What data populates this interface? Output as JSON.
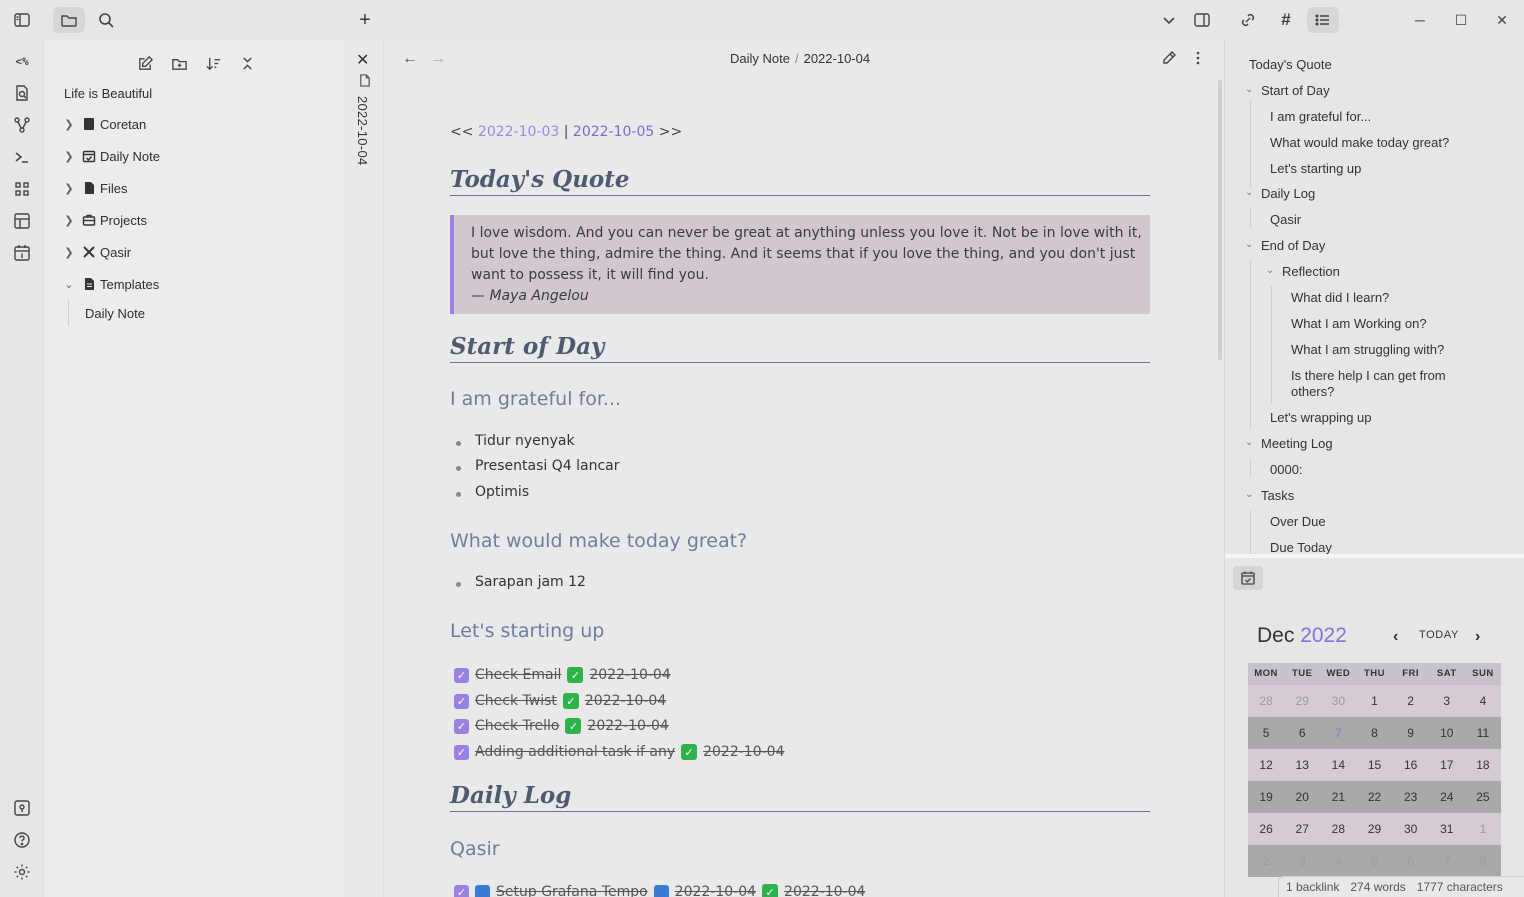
{
  "topbar": {
    "icons": [
      "sidebar-toggle-icon",
      "folder-icon",
      "search-icon",
      "plus-icon",
      "chevron-down-icon",
      "split-view-icon",
      "link-icon",
      "hashtag-icon",
      "list-icon"
    ],
    "window": [
      "minimize-icon",
      "maximize-icon",
      "close-icon"
    ],
    "minimize_glyph": "─",
    "maximize_glyph": "☐",
    "close_glyph": "✕",
    "plus_glyph": "+"
  },
  "ribbon": {
    "code_label": "<%",
    "icons": [
      "templater-icon",
      "file-search-icon",
      "graph-icon",
      "terminal-icon",
      "blocks-icon",
      "layout-icon",
      "calendar-day-icon",
      "help-vault-icon",
      "help-icon",
      "settings-icon"
    ]
  },
  "explorer": {
    "vault_name": "Life is Beautiful",
    "items": [
      {
        "label": "Coretan",
        "icon": "notebook-icon",
        "expanded": false
      },
      {
        "label": "Daily Note",
        "icon": "calendar-icon",
        "expanded": false
      },
      {
        "label": "Files",
        "icon": "files-icon",
        "expanded": false
      },
      {
        "label": "Projects",
        "icon": "briefcase-icon",
        "expanded": false
      },
      {
        "label": "Qasir",
        "icon": "tools-icon",
        "expanded": false
      },
      {
        "label": "Templates",
        "icon": "document-icon",
        "expanded": true
      }
    ],
    "sub_item": "Daily Note"
  },
  "tab": {
    "vertical_title": "2022-10-04",
    "close_glyph": "✕"
  },
  "editor": {
    "breadcrumb": {
      "folder": "Daily Note",
      "separator": "/",
      "file": "2022-10-04"
    },
    "back_glyph": "←",
    "forward_glyph": "→",
    "nav": {
      "prefix": "<<",
      "prev": "2022-10-03",
      "sep": "|",
      "next": "2022-10-05",
      "suffix": ">>"
    },
    "quote_heading": "Today's Quote",
    "quote_text": "I love wisdom. And you can never be great at anything unless you love it. Not be in love with it, but love the thing, admire the thing. And it seems that if you love the thing, and you don't just want to possess it, it will find you.",
    "quote_author": "— Maya Angelou",
    "start_heading": "Start of Day",
    "grateful_heading": "I am grateful for...",
    "grateful_items": [
      "Tidur nyenyak",
      "Presentasi Q4 lancar",
      "Optimis"
    ],
    "great_heading": "What would make today great?",
    "great_items": [
      "Sarapan jam 12"
    ],
    "starting_heading": "Let's starting up",
    "tasks": [
      {
        "text": "Check Email",
        "date": "2022-10-04"
      },
      {
        "text": "Check Twist",
        "date": "2022-10-04"
      },
      {
        "text": "Check Trello",
        "date": "2022-10-04"
      },
      {
        "text": "Adding additional task if any",
        "date": "2022-10-04"
      }
    ],
    "checkmark": "✓",
    "daily_log_heading": "Daily Log",
    "qasir_heading": "Qasir",
    "qasir_task": {
      "text": "Setup Grafana Tempo",
      "date1": "2022-10-04",
      "date2": "2022-10-04"
    }
  },
  "outline": {
    "items": [
      {
        "label": "Today's Quote"
      },
      {
        "label": "Start of Day"
      },
      {
        "label": "I am grateful for..."
      },
      {
        "label": "What would make today great?"
      },
      {
        "label": "Let's starting up"
      },
      {
        "label": "Daily Log"
      },
      {
        "label": "Qasir"
      },
      {
        "label": "End of Day"
      },
      {
        "label": "Reflection"
      },
      {
        "label": "What did I learn?"
      },
      {
        "label": "What I am Working on?"
      },
      {
        "label": "What I am struggling with?"
      },
      {
        "label": "Is there help I can get from others?"
      },
      {
        "label": "Let's wrapping up"
      },
      {
        "label": "Meeting Log"
      },
      {
        "label": "0000:"
      },
      {
        "label": "Tasks"
      },
      {
        "label": "Over Due"
      },
      {
        "label": "Due Today"
      }
    ]
  },
  "calendar": {
    "month": "Dec",
    "year": "2022",
    "today_label": "TODAY",
    "prev_glyph": "‹",
    "next_glyph": "›",
    "weekdays": [
      "MON",
      "TUE",
      "WED",
      "THU",
      "FRI",
      "SAT",
      "SUN"
    ],
    "weeks": [
      [
        "28",
        "29",
        "30",
        "1",
        "2",
        "3",
        "4"
      ],
      [
        "5",
        "6",
        "7",
        "8",
        "9",
        "10",
        "11"
      ],
      [
        "12",
        "13",
        "14",
        "15",
        "16",
        "17",
        "18"
      ],
      [
        "19",
        "20",
        "21",
        "22",
        "23",
        "24",
        "25"
      ],
      [
        "26",
        "27",
        "28",
        "29",
        "30",
        "31",
        "1"
      ],
      [
        "2",
        "3",
        "4",
        "5",
        "6",
        "7",
        "8"
      ]
    ],
    "highlight_day": "7",
    "accent_color": "#8a6fe0"
  },
  "status": {
    "backlinks": "1 backlink",
    "words": "274 words",
    "characters": "1777 characters"
  },
  "colors": {
    "accent": "#9a80e0",
    "heading": "#4e5a72",
    "subheading": "#6e7e9e",
    "quote_bg": "#d1c7d1",
    "done_green": "#2fb24c"
  }
}
